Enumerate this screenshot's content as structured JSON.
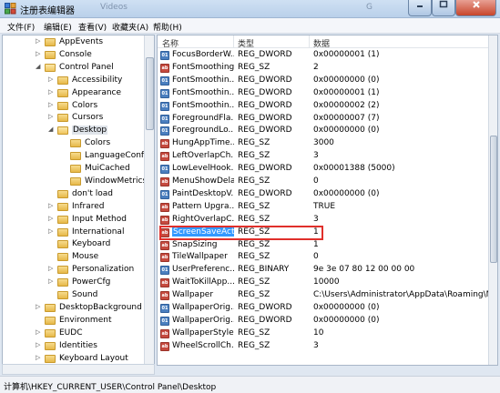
{
  "window": {
    "title": "注册表编辑器",
    "ghost_left": "Videos",
    "ghost_right": "G"
  },
  "menu": [
    "文件(F)",
    "编辑(E)",
    "查看(V)",
    "收藏夹(A)",
    "帮助(H)"
  ],
  "tree": [
    {
      "label": "AppEvents",
      "depth": 2,
      "expanded": false
    },
    {
      "label": "Console",
      "depth": 2,
      "expanded": false
    },
    {
      "label": "Control Panel",
      "depth": 2,
      "expanded": true
    },
    {
      "label": "Accessibility",
      "depth": 3,
      "expanded": false
    },
    {
      "label": "Appearance",
      "depth": 3,
      "expanded": false
    },
    {
      "label": "Colors",
      "depth": 3,
      "expanded": false
    },
    {
      "label": "Cursors",
      "depth": 3,
      "expanded": false
    },
    {
      "label": "Desktop",
      "depth": 3,
      "expanded": true,
      "selected": true
    },
    {
      "label": "Colors",
      "depth": 4,
      "leaf": true
    },
    {
      "label": "LanguageConfig",
      "depth": 4,
      "leaf": true
    },
    {
      "label": "MuiCached",
      "depth": 4,
      "leaf": true
    },
    {
      "label": "WindowMetrics",
      "depth": 4,
      "leaf": true
    },
    {
      "label": "don't load",
      "depth": 3,
      "leaf": true
    },
    {
      "label": "Infrared",
      "depth": 3,
      "expanded": false
    },
    {
      "label": "Input Method",
      "depth": 3,
      "expanded": false
    },
    {
      "label": "International",
      "depth": 3,
      "expanded": false
    },
    {
      "label": "Keyboard",
      "depth": 3,
      "leaf": true
    },
    {
      "label": "Mouse",
      "depth": 3,
      "leaf": true
    },
    {
      "label": "Personalization",
      "depth": 3,
      "expanded": false
    },
    {
      "label": "PowerCfg",
      "depth": 3,
      "expanded": false
    },
    {
      "label": "Sound",
      "depth": 3,
      "leaf": true
    },
    {
      "label": "DesktopBackground",
      "depth": 2,
      "expanded": false
    },
    {
      "label": "Environment",
      "depth": 2,
      "leaf": true
    },
    {
      "label": "EUDC",
      "depth": 2,
      "expanded": false
    },
    {
      "label": "Identities",
      "depth": 2,
      "expanded": false
    },
    {
      "label": "Keyboard Layout",
      "depth": 2,
      "expanded": false
    }
  ],
  "list": {
    "headers": {
      "name": "名称",
      "type": "类型",
      "data": "数据"
    },
    "rows": [
      {
        "name": "FocusBorderW...",
        "type": "REG_DWORD",
        "data": "0x00000001 (1)",
        "icon": "num"
      },
      {
        "name": "FontSmoothing",
        "type": "REG_SZ",
        "data": "2",
        "icon": "sz"
      },
      {
        "name": "FontSmoothin...",
        "type": "REG_DWORD",
        "data": "0x00000000 (0)",
        "icon": "num"
      },
      {
        "name": "FontSmoothin...",
        "type": "REG_DWORD",
        "data": "0x00000001 (1)",
        "icon": "num"
      },
      {
        "name": "FontSmoothin...",
        "type": "REG_DWORD",
        "data": "0x00000002 (2)",
        "icon": "num"
      },
      {
        "name": "ForegroundFla...",
        "type": "REG_DWORD",
        "data": "0x00000007 (7)",
        "icon": "num"
      },
      {
        "name": "ForegroundLo...",
        "type": "REG_DWORD",
        "data": "0x00000000 (0)",
        "icon": "num"
      },
      {
        "name": "HungAppTime...",
        "type": "REG_SZ",
        "data": "3000",
        "icon": "sz"
      },
      {
        "name": "LeftOverlapCh...",
        "type": "REG_SZ",
        "data": "3",
        "icon": "sz"
      },
      {
        "name": "LowLevelHook...",
        "type": "REG_DWORD",
        "data": "0x00001388 (5000)",
        "icon": "num"
      },
      {
        "name": "MenuShowDelay",
        "type": "REG_SZ",
        "data": "0",
        "icon": "sz"
      },
      {
        "name": "PaintDesktopV...",
        "type": "REG_DWORD",
        "data": "0x00000000 (0)",
        "icon": "num"
      },
      {
        "name": "Pattern Upgra...",
        "type": "REG_SZ",
        "data": "TRUE",
        "icon": "sz"
      },
      {
        "name": "RightOverlapC...",
        "type": "REG_SZ",
        "data": "3",
        "icon": "sz"
      },
      {
        "name": "ScreenSaveActi...",
        "type": "REG_SZ",
        "data": "1",
        "icon": "sz",
        "selected": true
      },
      {
        "name": "SnapSizing",
        "type": "REG_SZ",
        "data": "1",
        "icon": "sz"
      },
      {
        "name": "TileWallpaper",
        "type": "REG_SZ",
        "data": "0",
        "icon": "sz"
      },
      {
        "name": "UserPreferenc...",
        "type": "REG_BINARY",
        "data": "9e 3e 07 80 12 00 00 00",
        "icon": "num"
      },
      {
        "name": "WaitToKillApp...",
        "type": "REG_SZ",
        "data": "10000",
        "icon": "sz"
      },
      {
        "name": "Wallpaper",
        "type": "REG_SZ",
        "data": "C:\\Users\\Administrator\\AppData\\Roaming\\Mi...",
        "icon": "sz"
      },
      {
        "name": "WallpaperOrig...",
        "type": "REG_DWORD",
        "data": "0x00000000 (0)",
        "icon": "num"
      },
      {
        "name": "WallpaperOrig...",
        "type": "REG_DWORD",
        "data": "0x00000000 (0)",
        "icon": "num"
      },
      {
        "name": "WallpaperStyle",
        "type": "REG_SZ",
        "data": "10",
        "icon": "sz"
      },
      {
        "name": "WheelScrollCh...",
        "type": "REG_SZ",
        "data": "3",
        "icon": "sz"
      }
    ]
  },
  "status": "计算机\\HKEY_CURRENT_USER\\Control Panel\\Desktop",
  "colors": {
    "selection": "#3399ff",
    "highlight_box": "#e0302b"
  }
}
